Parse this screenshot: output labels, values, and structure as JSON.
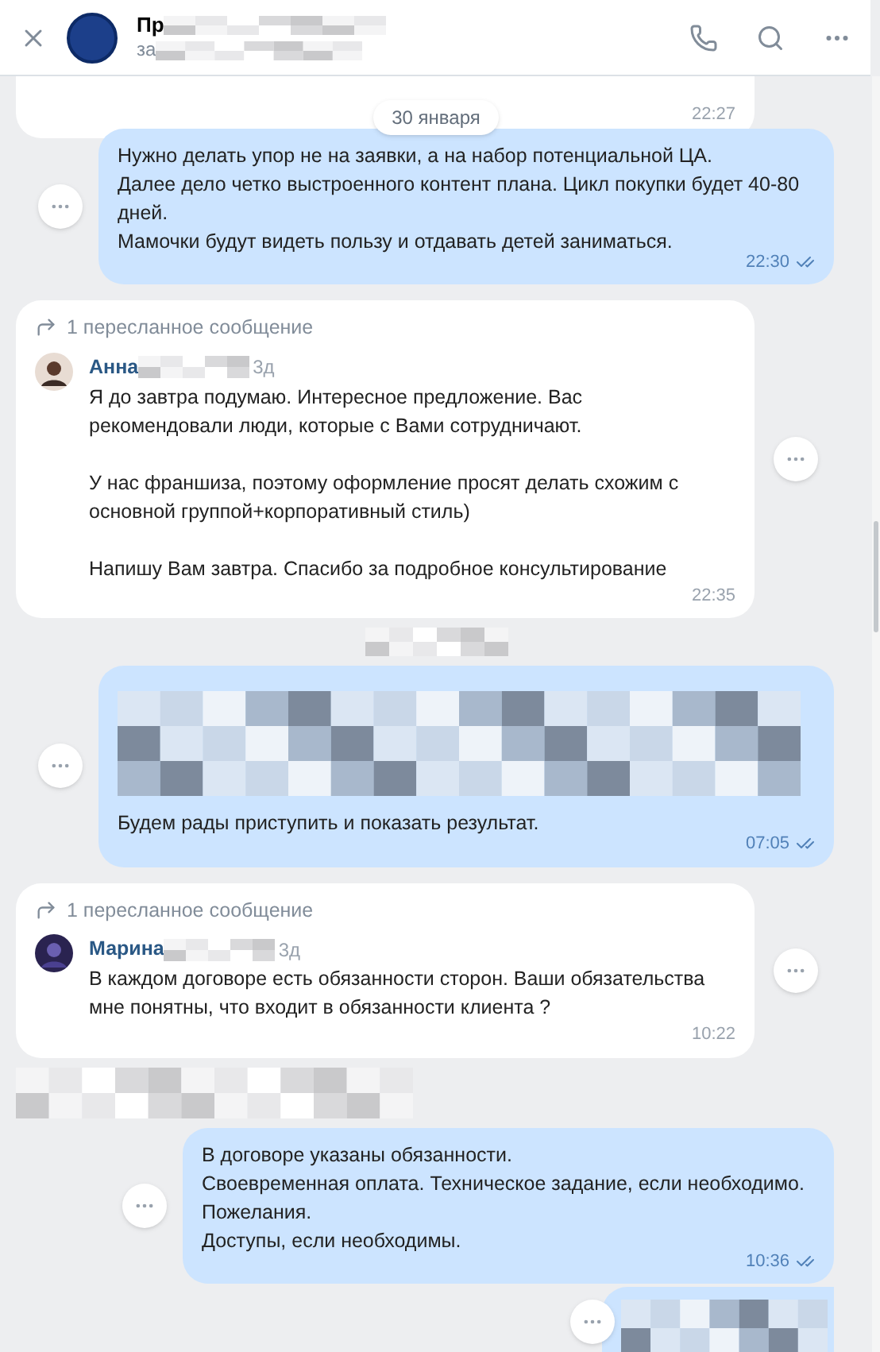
{
  "header": {
    "title": "Пр",
    "subtitle": "за"
  },
  "messages": [
    {
      "kind": "tail",
      "time": "22:27"
    },
    {
      "kind": "date",
      "label": "30 января"
    },
    {
      "kind": "outgoing",
      "lines": [
        "Нужно делать упор не на заявки, а на набор потенциальной ЦА.",
        "Далее дело четко выстроенного контент плана. Цикл покупки будет 40-80 дней.",
        "Мамочки будут видеть пользу и отдавать детей заниматься."
      ],
      "time": "22:30",
      "read": true
    },
    {
      "kind": "incoming",
      "forwarded": "1 пересланное сообщение",
      "author": "Анна",
      "ago": "3д",
      "paragraphs": [
        "Я до завтра подумаю. Интересное предложение.  Вас рекомендовали люди, которые с Вами сотрудничают.",
        "У нас франшиза, поэтому оформление просят делать схожим с основной группой+корпоративный стиль)",
        "Напишу Вам завтра. Спасибо за подробное консультирование"
      ],
      "time": "22:35"
    },
    {
      "kind": "redacted"
    },
    {
      "kind": "mixed",
      "lines": [
        "Будем рады приступить и показать результат."
      ],
      "time": "07:05",
      "read": true
    },
    {
      "kind": "incoming",
      "forwarded": "1 пересланное сообщение",
      "author": "Марина",
      "ago": "3д",
      "paragraphs": [
        "В каждом договоре есть обязанности сторон. Ваши обязательства мне понятны, что входит в обязанности клиента ?"
      ],
      "time": "10:22"
    },
    {
      "kind": "redacted"
    },
    {
      "kind": "outgoing",
      "lines": [
        "В договоре указаны обязанности.",
        "Своевременная оплата. Техническое задание, если необходимо.",
        "Пожелания.",
        "Доступы, если необходимы."
      ],
      "time": "10:36",
      "read": true
    },
    {
      "kind": "hidden"
    }
  ]
}
